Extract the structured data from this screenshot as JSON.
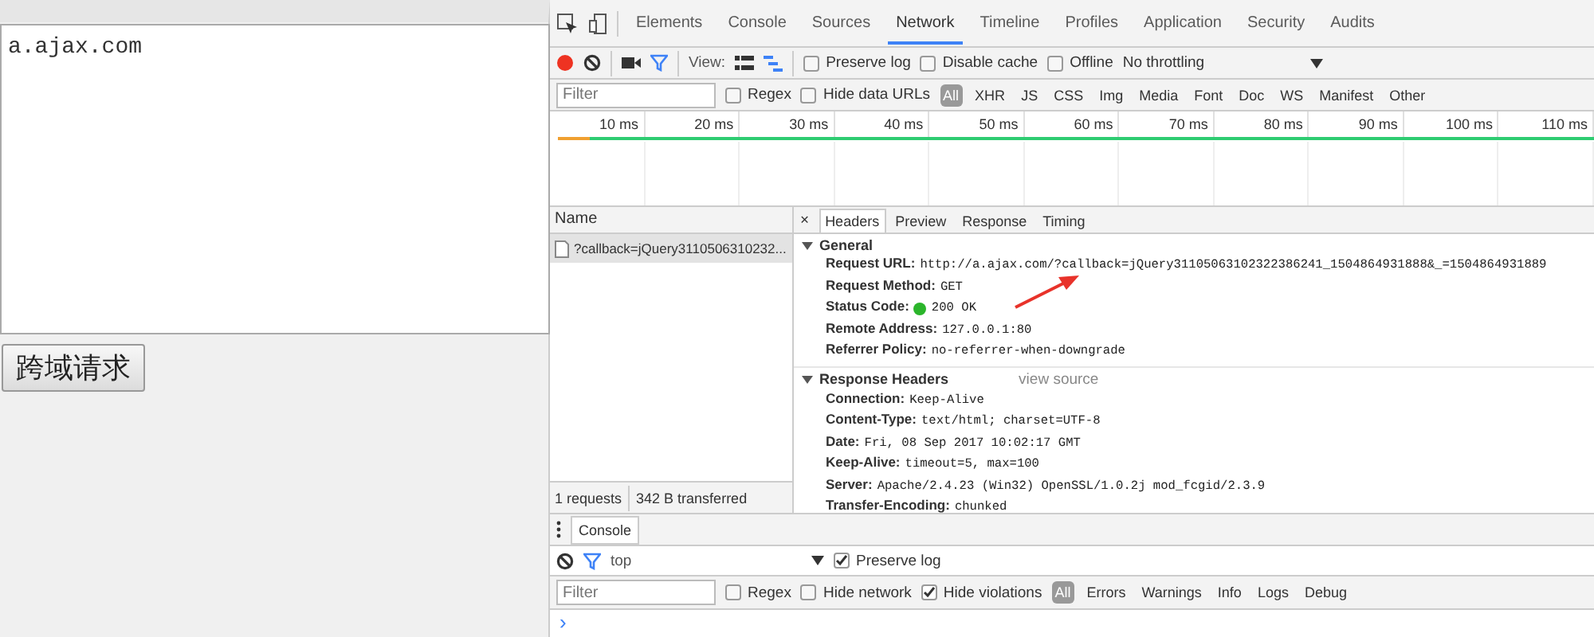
{
  "page": {
    "textarea_value": "a.ajax.com",
    "button": "跨域请求"
  },
  "devtools": {
    "tabs": [
      {
        "label": "Elements",
        "selected": false
      },
      {
        "label": "Console",
        "selected": false
      },
      {
        "label": "Sources",
        "selected": false
      },
      {
        "label": "Network",
        "selected": true
      },
      {
        "label": "Timeline",
        "selected": false
      },
      {
        "label": "Profiles",
        "selected": false
      },
      {
        "label": "Application",
        "selected": false
      },
      {
        "label": "Security",
        "selected": false
      },
      {
        "label": "Audits",
        "selected": false
      }
    ],
    "toolbar": {
      "recording": true,
      "view_label": "View:",
      "checks": [
        {
          "label": "Preserve log",
          "checked": false
        },
        {
          "label": "Disable cache",
          "checked": false
        },
        {
          "label": "Offline",
          "checked": false
        }
      ],
      "throttling": "No throttling"
    },
    "filter": {
      "placeholder": "Filter",
      "checks": [
        {
          "label": "Regex",
          "checked": false
        },
        {
          "label": "Hide data URLs",
          "checked": false
        }
      ],
      "types": [
        {
          "label": "All",
          "selected": true
        },
        {
          "label": "XHR",
          "selected": false
        },
        {
          "label": "JS",
          "selected": false
        },
        {
          "label": "CSS",
          "selected": false
        },
        {
          "label": "Img",
          "selected": false
        },
        {
          "label": "Media",
          "selected": false
        },
        {
          "label": "Font",
          "selected": false
        },
        {
          "label": "Doc",
          "selected": false
        },
        {
          "label": "WS",
          "selected": false
        },
        {
          "label": "Manifest",
          "selected": false
        },
        {
          "label": "Other",
          "selected": false
        }
      ]
    },
    "timeline": {
      "ticks": [
        "10 ms",
        "20 ms",
        "30 ms",
        "40 ms",
        "50 ms",
        "60 ms",
        "70 ms",
        "80 ms",
        "90 ms",
        "100 ms",
        "110 ms"
      ]
    },
    "requests": {
      "column": "Name",
      "rows": [
        {
          "name": "?callback=jQuery3110506310232...",
          "selected": true
        }
      ],
      "summary": [
        "1 requests",
        "342 B transferred"
      ]
    },
    "details": {
      "close": "×",
      "tabs": [
        {
          "label": "Headers",
          "selected": true
        },
        {
          "label": "Preview",
          "selected": false
        },
        {
          "label": "Response",
          "selected": false
        },
        {
          "label": "Timing",
          "selected": false
        }
      ],
      "sections": [
        {
          "title": "General",
          "expanded": true,
          "rows": [
            {
              "kind": "plain",
              "key": "Request URL:",
              "value": "http://a.ajax.com/?callback=jQuery31105063102322386241_1504864931888&_=1504864931889"
            },
            {
              "kind": "plain",
              "key": "Request Method:",
              "value": "GET"
            },
            {
              "kind": "status",
              "key": "Status Code:",
              "value": "200 OK"
            },
            {
              "kind": "plain",
              "key": "Remote Address:",
              "value": "127.0.0.1:80"
            },
            {
              "kind": "plain",
              "key": "Referrer Policy:",
              "value": "no-referrer-when-downgrade"
            }
          ]
        },
        {
          "title": "Response Headers",
          "expanded": true,
          "link": "view source",
          "rows": [
            {
              "kind": "plain",
              "key": "Connection:",
              "value": "Keep-Alive"
            },
            {
              "kind": "plain",
              "key": "Content-Type:",
              "value": "text/html; charset=UTF-8"
            },
            {
              "kind": "plain",
              "key": "Date:",
              "value": "Fri, 08 Sep 2017 10:02:17 GMT"
            },
            {
              "kind": "plain",
              "key": "Keep-Alive:",
              "value": "timeout=5, max=100"
            },
            {
              "kind": "plain",
              "key": "Server:",
              "value": "Apache/2.4.23 (Win32) OpenSSL/1.0.2j mod_fcgid/2.3.9"
            },
            {
              "kind": "plain",
              "key": "Transfer-Encoding:",
              "value": "chunked"
            }
          ]
        }
      ]
    },
    "drawer": {
      "tab": "Console",
      "context": "top",
      "preserve_log": {
        "label": "Preserve log",
        "checked": true
      },
      "filter_placeholder": "Filter",
      "checks": [
        {
          "label": "Regex",
          "checked": false
        },
        {
          "label": "Hide network",
          "checked": false
        },
        {
          "label": "Hide violations",
          "checked": true
        }
      ],
      "levels": [
        {
          "label": "All",
          "selected": true
        },
        {
          "label": "Errors",
          "selected": false
        },
        {
          "label": "Warnings",
          "selected": false
        },
        {
          "label": "Info",
          "selected": false
        },
        {
          "label": "Logs",
          "selected": false
        },
        {
          "label": "Debug",
          "selected": false
        }
      ],
      "prompt": "›"
    }
  }
}
